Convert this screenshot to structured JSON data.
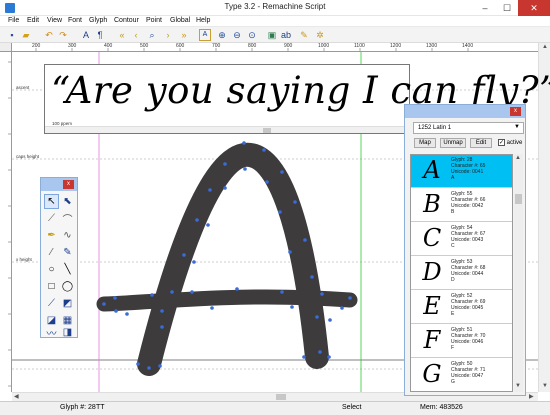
{
  "window": {
    "title": "Type 3.2  -  Remachine Script",
    "minimize": "–",
    "maximize": "☐",
    "close": "✕"
  },
  "menu": [
    "File",
    "Edit",
    "View",
    "Font",
    "Glyph",
    "Contour",
    "Point",
    "Global",
    "Help"
  ],
  "ruler": {
    "top_labels": [
      "200",
      "300",
      "400",
      "500",
      "600",
      "700",
      "800",
      "900",
      "1000",
      "1100",
      "1200",
      "1300",
      "1400"
    ]
  },
  "guides": {
    "ascent": "ascent",
    "caps_height": "caps height",
    "x_height": "x height"
  },
  "preview": {
    "text": "“Are you saying I can fly?”",
    "size": "100 ppem"
  },
  "palette": {
    "close": "x"
  },
  "glyph_list": {
    "close": "x",
    "codepage": "1252 Latin 1",
    "buttons": [
      "Map",
      "Unmap",
      "Edit"
    ],
    "active_label": "active",
    "active_checked": "✓",
    "rows": [
      {
        "char": "A",
        "glyph": "Glyph: 28",
        "character": "Character #: 65",
        "unicode": "Unicode: 0041",
        "name": "A",
        "selected": true
      },
      {
        "char": "B",
        "glyph": "Glyph: 55",
        "character": "Character #: 66",
        "unicode": "Unicode: 0042",
        "name": "B",
        "selected": false
      },
      {
        "char": "C",
        "glyph": "Glyph: 54",
        "character": "Character #: 67",
        "unicode": "Unicode: 0043",
        "name": "C",
        "selected": false
      },
      {
        "char": "D",
        "glyph": "Glyph: 53",
        "character": "Character #: 68",
        "unicode": "Unicode: 0044",
        "name": "D",
        "selected": false
      },
      {
        "char": "E",
        "glyph": "Glyph: 52",
        "character": "Character #: 69",
        "unicode": "Unicode: 0045",
        "name": "E",
        "selected": false
      },
      {
        "char": "F",
        "glyph": "Glyph: 51",
        "character": "Character #: 70",
        "unicode": "Unicode: 0046",
        "name": "F",
        "selected": false
      },
      {
        "char": "G",
        "glyph": "Glyph: 50",
        "character": "Character #: 71",
        "unicode": "Unicode: 0047",
        "name": "G",
        "selected": false
      }
    ]
  },
  "status": {
    "glyph": "Glyph #: 28",
    "mode": "TT",
    "tool": "Select",
    "mem": "Mem: 483526"
  },
  "colors": {
    "glyph_fill": "#3d3b3b",
    "point": "#3a6bd8",
    "selected_row": "#00bff3",
    "guide_magenta": "#e07be0",
    "guide_green": "#33cc33"
  }
}
